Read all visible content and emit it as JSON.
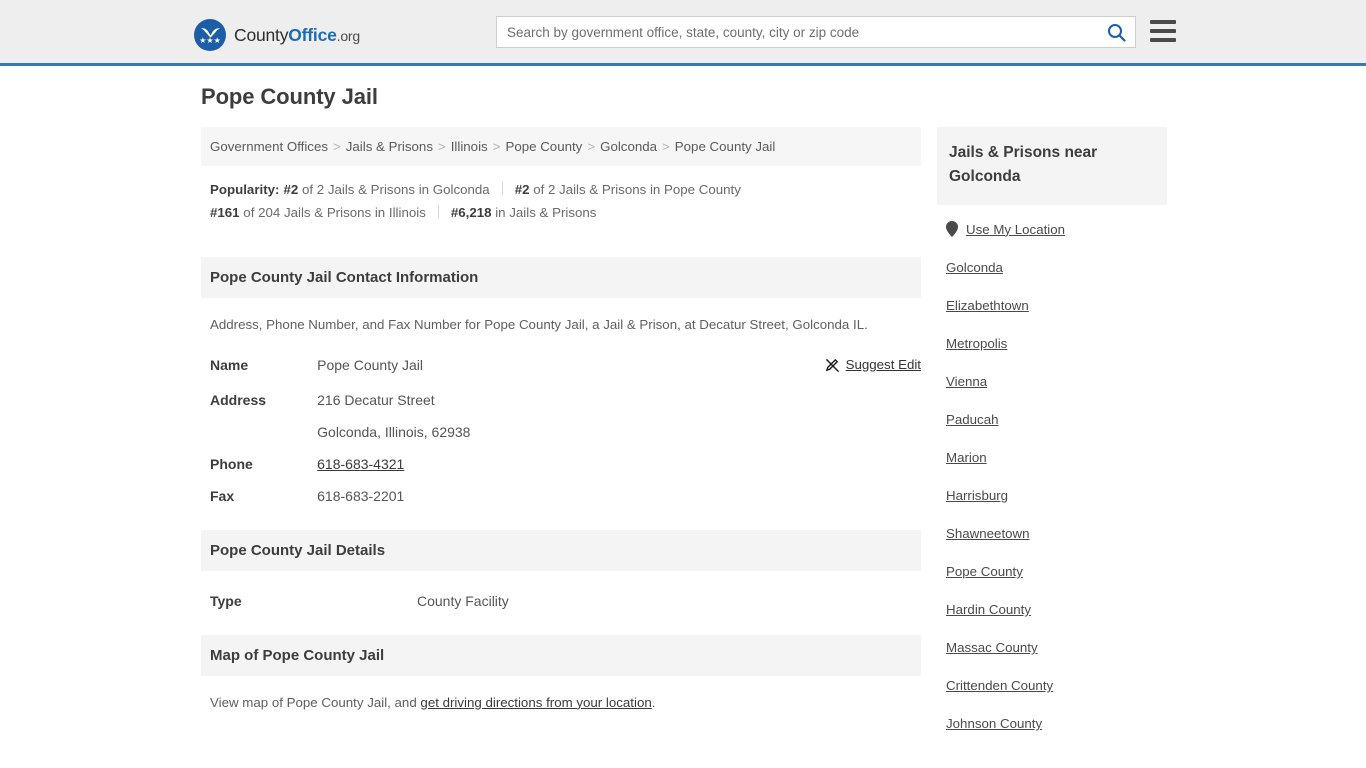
{
  "header": {
    "brand": {
      "part1": "County",
      "part2": "Office",
      "part3": ".org",
      "logo_icon": "eagle-shield-logo"
    },
    "search": {
      "placeholder": "Search by government office, state, county, city or zip code",
      "value": "",
      "search_icon": "search-icon"
    },
    "menu": {
      "icon": "hamburger-menu-icon"
    },
    "accent_color": "#3d76ab"
  },
  "page": {
    "title": "Pope County Jail"
  },
  "breadcrumb": {
    "separator": ">",
    "items": [
      "Government Offices",
      "Jails & Prisons",
      "Illinois",
      "Pope County",
      "Golconda",
      "Pope County Jail"
    ]
  },
  "popularity": {
    "label": "Popularity:",
    "items": [
      {
        "rank": "#2",
        "text": "of 2 Jails & Prisons in Golconda"
      },
      {
        "rank": "#2",
        "text": "of 2 Jails & Prisons in Pope County"
      },
      {
        "rank": "#161",
        "text": "of 204 Jails & Prisons in Illinois"
      },
      {
        "rank": "#6,218",
        "text": "in Jails & Prisons"
      }
    ]
  },
  "contact": {
    "heading": "Pope County Jail Contact Information",
    "description": "Address, Phone Number, and Fax Number for Pope County Jail, a Jail & Prison, at Decatur Street, Golconda IL.",
    "suggest_edit": {
      "label": "Suggest Edit",
      "icon": "edit-pencil-icon"
    },
    "rows": [
      {
        "key": "Name",
        "value": "Pope County Jail",
        "link": false
      },
      {
        "key": "Address",
        "value": "216 Decatur Street",
        "link": false
      },
      {
        "key": "",
        "value": "Golconda, Illinois, 62938",
        "link": false
      },
      {
        "key": "Phone",
        "value": "618-683-4321",
        "link": true
      },
      {
        "key": "Fax",
        "value": "618-683-2201",
        "link": false
      }
    ]
  },
  "details": {
    "heading": "Pope County Jail Details",
    "rows": [
      {
        "key": "Type",
        "value": "County Facility"
      }
    ]
  },
  "map": {
    "heading": "Map of Pope County Jail",
    "text_before": "View map of Pope County Jail, and ",
    "link_text": "get driving directions from your location",
    "text_after": "."
  },
  "sidebar": {
    "heading": "Jails & Prisons near Golconda",
    "use_my_location": {
      "label": "Use My Location",
      "icon": "map-pin-icon"
    },
    "items": [
      "Golconda",
      "Elizabethtown",
      "Metropolis",
      "Vienna",
      "Paducah",
      "Marion",
      "Harrisburg",
      "Shawneetown",
      "Pope County",
      "Hardin County",
      "Massac County",
      "Crittenden County",
      "Johnson County"
    ]
  }
}
